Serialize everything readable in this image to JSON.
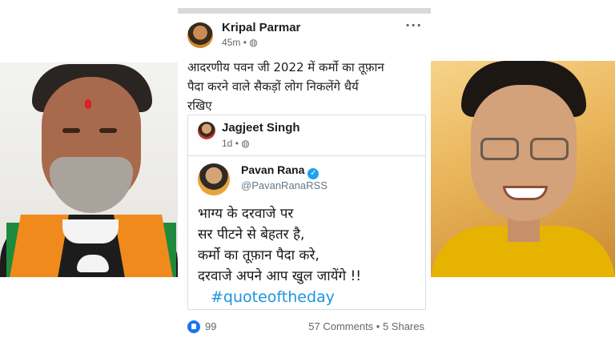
{
  "post": {
    "author": "Kripal Parmar",
    "time": "45m",
    "privacy_icon": "globe-icon",
    "more_label": "···",
    "text_lines": [
      "आदरणीय पवन जी 2022 में कर्मो का तूफ़ान",
      "पैदा करने वाले सैकड़ों लोग निकलेंगे धैर्य",
      "रखिए"
    ]
  },
  "shared_post": {
    "author": "Jagjeet Singh",
    "time": "1d",
    "privacy_icon": "globe-icon"
  },
  "tweet": {
    "name": "Pavan Rana",
    "verified_mark": "✓",
    "handle": "@PavanRanaRSS",
    "lines": [
      "भाग्य के दरवाजे पर",
      "सर पीटने से बेहतर है,",
      "कर्मो का तूफ़ान पैदा करे,",
      "दरवाजे अपने आप खुल जायेंगे !!"
    ],
    "hashtag": "#quoteoftheday"
  },
  "footer": {
    "like_count": "99",
    "comments_shares": "57 Comments • 5 Shares"
  },
  "colors": {
    "facebook_blue": "#1877f2",
    "twitter_blue": "#1da1f2",
    "hashtag_blue": "#1b95e0",
    "bjp_saffron": "#f08a1c"
  }
}
